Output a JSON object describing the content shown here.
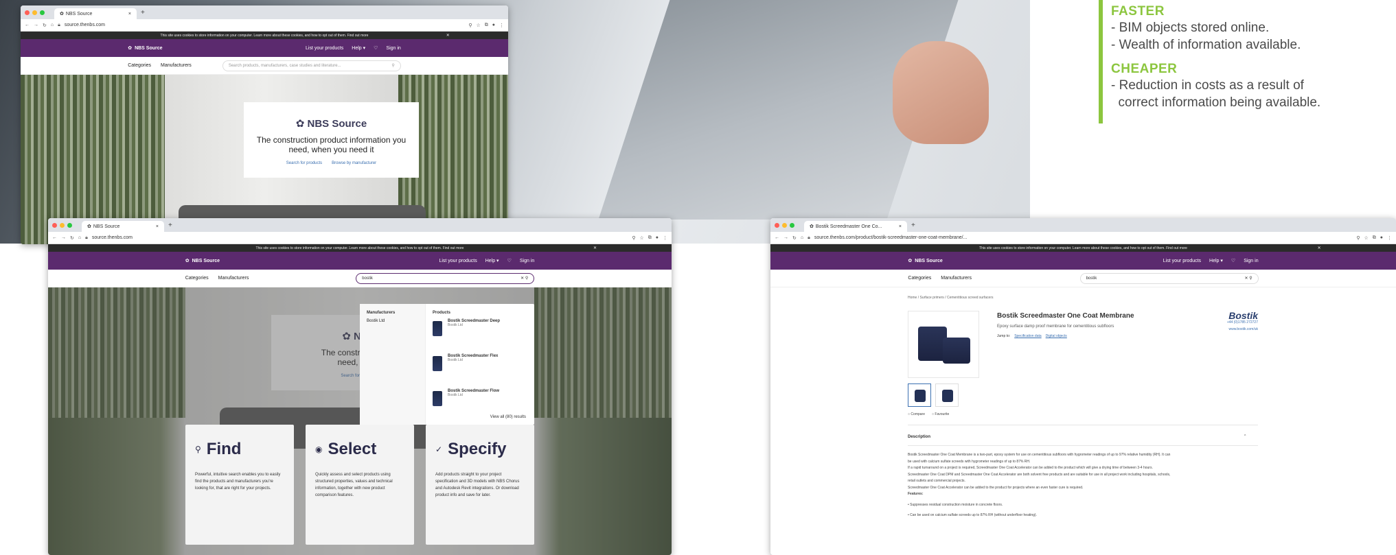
{
  "right_panel": {
    "accent": "#8cc63f",
    "faster": {
      "heading": "FASTER",
      "lines": [
        "- BIM objects stored online.",
        "- Wealth of information available."
      ]
    },
    "cheaper": {
      "heading": "CHEAPER",
      "lines": [
        "- Reduction in costs as a result of",
        "  correct information being available."
      ]
    }
  },
  "browser1": {
    "tab_title": "NBS Source",
    "url": "source.thenbs.com",
    "cookie": "This site uses cookies to store information on your computer. Learn more about these cookies, and how to opt out of them. Find out more",
    "brand": "NBS Source",
    "top_links": [
      "List your products",
      "Help ▾",
      "Sign in"
    ],
    "nav": [
      "Categories",
      "Manufacturers"
    ],
    "search_placeholder": "Search products, manufacturers, case studies and literature...",
    "card": {
      "title": "NBS Source",
      "subtitle_1": "The construction product information you",
      "subtitle_2": "need, when you need it",
      "link_1": "Search for products",
      "link_2": "Browse by manufacturer"
    }
  },
  "browser2": {
    "tab_title": "NBS Source",
    "url": "source.thenbs.com",
    "cookie": "This site uses cookies to store information on your computer. Learn more about these cookies, and how to opt out of them. Find out more",
    "brand": "NBS Source",
    "top_links": [
      "List your products",
      "Help ▾",
      "Sign in"
    ],
    "nav": [
      "Categories",
      "Manufacturers"
    ],
    "search_value": "bostik",
    "card": {
      "title": "NBS",
      "subtitle_1": "The construction pro",
      "subtitle_2": "need, when",
      "link_1": "Search for products"
    },
    "dropdown": {
      "manufacturers_heading": "Manufacturers",
      "manufacturer": "Bostik Ltd",
      "products_heading": "Products",
      "products": [
        {
          "name": "Bostik Screedmaster Deep",
          "brand": "Bostik Ltd"
        },
        {
          "name": "Bostik Screedmaster Flex",
          "brand": "Bostik Ltd"
        },
        {
          "name": "Bostik Screedmaster Flow",
          "brand": "Bostik Ltd"
        }
      ],
      "view_all": "View all (80) results"
    },
    "features": [
      {
        "icon": "search-icon",
        "glyph": "⚲",
        "title": "Find",
        "text": "Powerful, intuitive search enables you to easily find the products and manufacturers you're looking for, that are right for your projects."
      },
      {
        "icon": "select-icon",
        "glyph": "◉",
        "title": "Select",
        "text": "Quickly assess and select products using structured properties, values and technical information, together with new product comparison features."
      },
      {
        "icon": "check-icon",
        "glyph": "✓",
        "title": "Specify",
        "text": "Add products straight to your project specification and 3D models with NBS Chorus and Autodesk Revit integrations. Or download product info and save for later."
      }
    ]
  },
  "browser3": {
    "tab_title": "Bostik Screedmaster One Co...",
    "url": "source.thenbs.com/product/bostik-screedmaster-one-coat-membrane/...",
    "cookie": "This site uses cookies to store information on your computer. Learn more about these cookies, and how to opt out of them. Find out more",
    "brand": "NBS Source",
    "top_links": [
      "List your products",
      "Help ▾",
      "Sign in"
    ],
    "nav": [
      "Categories",
      "Manufacturers"
    ],
    "search_value": "bostik",
    "breadcrumb": "Home  /  Surface primers  /  Cementitious screed surfacers",
    "product_title": "Bostik Screedmaster One Coat Membrane",
    "product_desc": "Epoxy surface damp proof membrane for cementitious subfloors",
    "jump_label": "Jump to:",
    "jump_links": [
      "Specification data",
      "Digital objects"
    ],
    "manufacturer": {
      "name": "Bostik",
      "phone": "+44 (0)1785 272727",
      "web": "www.bostik.com/uk"
    },
    "compare": [
      "Compare",
      "Favourite"
    ],
    "description_heading": "Description",
    "description_lines": [
      "Bostik Screedmaster One Coat Membrane is a two-part, epoxy system for use on cementitious subfloors with hygrometer readings of up to 97% relative humidity (RH). It can",
      "be used with calcium sulfate screeds with hygrometer readings of up to 87% RH.",
      "If a rapid turnaround on a project is required, Screedmaster One Coat Accelerator can be added to the product which will give a drying time of between 3-4 hours.",
      "Screedmaster One Coat DPM and Screedmaster One Coat Accelerator are both solvent free products and are suitable for use in all project work including hospitals, schools,",
      "retail outlets and commercial projects.",
      "Screedmaster One Coat Accelerator can be added to the product for projects where an even faster cure is required.",
      "Features:",
      "•  Suppresses residual construction moisture in concrete floors.",
      "•  Can be used on calcium sulfate screeds up to 87% RH (without underfloor heating)."
    ]
  }
}
